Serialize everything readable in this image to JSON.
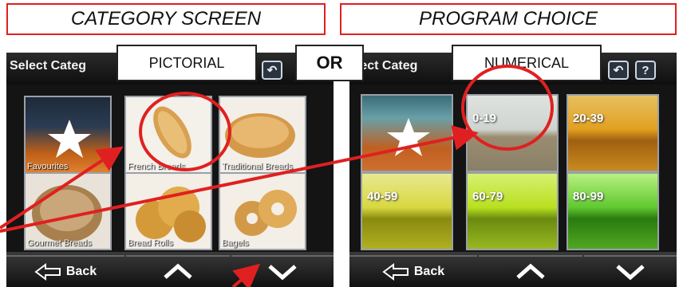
{
  "captions": {
    "left": "CATEGORY SCREEN",
    "right": "PROGRAM CHOICE"
  },
  "overlays": {
    "pictorial": "PICTORIAL",
    "or": "OR",
    "numerical": "NUMERICAL"
  },
  "left_screen": {
    "title": "Select Categ",
    "tiles": [
      {
        "label": "Favourites",
        "icon": "star-icon"
      },
      {
        "label": "French Breads",
        "icon": "baguette-image"
      },
      {
        "label": "Traditional Breads",
        "icon": "loaf-image"
      },
      {
        "label": "Gourmet Breads",
        "icon": "gourmet-loaf-image"
      },
      {
        "label": "Bread Rolls",
        "icon": "rolls-image"
      },
      {
        "label": "Bagels",
        "icon": "bagels-image"
      }
    ],
    "back_label": "Back"
  },
  "right_screen": {
    "title": "elect Categ",
    "tiles": [
      {
        "label": "",
        "icon": "star-icon"
      },
      {
        "label": "0-19"
      },
      {
        "label": "20-39"
      },
      {
        "label": "40-59"
      },
      {
        "label": "60-79"
      },
      {
        "label": "80-99"
      }
    ],
    "back_label": "Back"
  },
  "colors": {
    "annotation_red": "#e02020"
  }
}
